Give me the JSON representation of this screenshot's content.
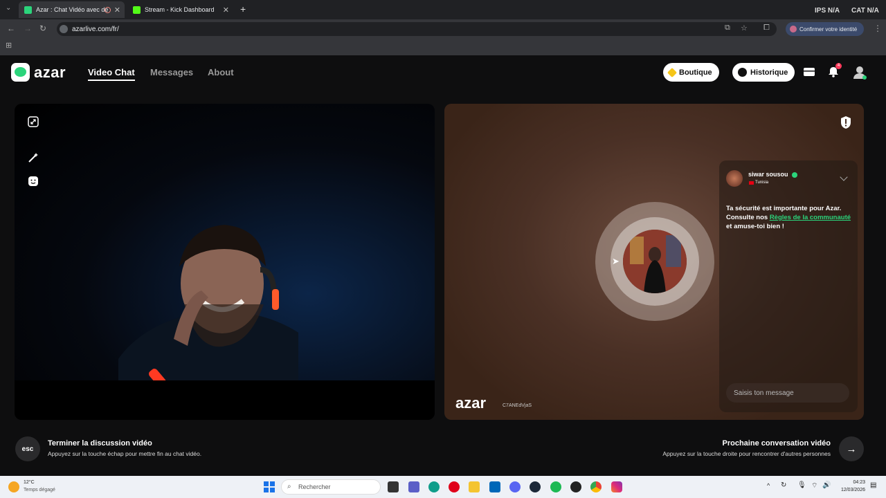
{
  "browser": {
    "tabs": [
      {
        "title": "Azar : Chat Vidéo avec de",
        "favicon_color": "#2bd47b",
        "active": true
      },
      {
        "title": "Stream - Kick Dashboard",
        "favicon_color": "#53fc18",
        "active": false
      }
    ],
    "url": "azarlive.com/fr/",
    "confirm_identity": "Confirmer votre identité",
    "top_right": [
      "IPS",
      "N/A",
      "CAT",
      "N/A"
    ]
  },
  "header": {
    "logo_text": "azar",
    "nav": [
      "Video Chat",
      "Messages",
      "About"
    ],
    "shop_label": "Boutique",
    "history_label": "Historique",
    "notification_count": "4"
  },
  "remote": {
    "user_name": "siwar sousou",
    "country": "Tunisia",
    "safety_msg_part1": "Ta sécurité est importante pour Azar. Consulte nos ",
    "safety_link": "Règles de la communauté",
    "safety_msg_part2": " et amuse-toi bien !",
    "message_placeholder": "Saisis ton message",
    "watermark": "azar",
    "watermark_code": "C7ANEdVjaS"
  },
  "footer": {
    "esc_label": "esc",
    "end_title": "Terminer la discussion vidéo",
    "end_sub": "Appuyez sur la touche échap pour mettre fin au chat vidéo.",
    "next_title": "Prochaine conversation vidéo",
    "next_sub": "Appuyez sur la touche droite pour rencontrer d'autres personnes"
  },
  "taskbar": {
    "weather_temp": "12°C",
    "weather_desc": "Temps dégagé",
    "search_placeholder": "Rechercher",
    "time": "04:23",
    "date": "12/03/2026"
  },
  "colors": {
    "accent": "#2bd47b",
    "background": "#0e0e0f"
  }
}
